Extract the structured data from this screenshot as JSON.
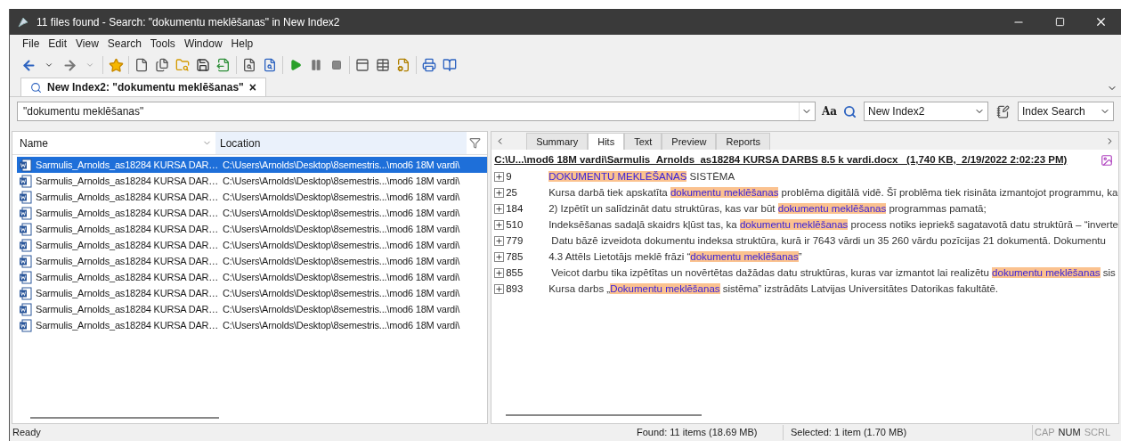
{
  "window": {
    "title": "11 files found - Search: \"dokumentu meklēšanas\" in New Index2"
  },
  "menu": [
    "File",
    "Edit",
    "View",
    "Search",
    "Tools",
    "Window",
    "Help"
  ],
  "doc_tab": {
    "label": "New Index2: \"dokumentu meklēšanas\"",
    "close": "×"
  },
  "search": {
    "value": "\"dokumentu meklēšanas\"",
    "case_button": "Aa",
    "index": "New Index2",
    "mode": "Index Search"
  },
  "results": {
    "columns": [
      "Name",
      "Location"
    ],
    "rows": [
      {
        "name": "Sarmulis_Arnolds_as18284 KURSA DAR…",
        "location": "C:\\Users\\Arnolds\\Desktop\\8semestris...\\mod6 18M vardi\\",
        "selected": true
      },
      {
        "name": "Sarmulis_Arnolds_as18284 KURSA DAR…",
        "location": "C:\\Users\\Arnolds\\Desktop\\8semestris...\\mod6 18M vardi\\",
        "selected": false
      },
      {
        "name": "Sarmulis_Arnolds_as18284 KURSA DAR…",
        "location": "C:\\Users\\Arnolds\\Desktop\\8semestris...\\mod6 18M vardi\\",
        "selected": false
      },
      {
        "name": "Sarmulis_Arnolds_as18284 KURSA DAR…",
        "location": "C:\\Users\\Arnolds\\Desktop\\8semestris...\\mod6 18M vardi\\",
        "selected": false
      },
      {
        "name": "Sarmulis_Arnolds_as18284 KURSA DAR…",
        "location": "C:\\Users\\Arnolds\\Desktop\\8semestris...\\mod6 18M vardi\\",
        "selected": false
      },
      {
        "name": "Sarmulis_Arnolds_as18284 KURSA DAR…",
        "location": "C:\\Users\\Arnolds\\Desktop\\8semestris...\\mod6 18M vardi\\",
        "selected": false
      },
      {
        "name": "Sarmulis_Arnolds_as18284 KURSA DAR…",
        "location": "C:\\Users\\Arnolds\\Desktop\\8semestris...\\mod6 18M vardi\\",
        "selected": false
      },
      {
        "name": "Sarmulis_Arnolds_as18284 KURSA DAR…",
        "location": "C:\\Users\\Arnolds\\Desktop\\8semestris...\\mod6 18M vardi\\",
        "selected": false
      },
      {
        "name": "Sarmulis_Arnolds_as18284 KURSA DAR…",
        "location": "C:\\Users\\Arnolds\\Desktop\\8semestris...\\mod6 18M vardi\\",
        "selected": false
      },
      {
        "name": "Sarmulis_Arnolds_as18284 KURSA DAR…",
        "location": "C:\\Users\\Arnolds\\Desktop\\8semestris...\\mod6 18M vardi\\",
        "selected": false
      },
      {
        "name": "Sarmulis_Arnolds_as18284 KURSA DAR…",
        "location": "C:\\Users\\Arnolds\\Desktop\\8semestris...\\mod6 18M vardi\\",
        "selected": false
      }
    ]
  },
  "viewer": {
    "tabs": [
      {
        "label": "Summary",
        "selected": false
      },
      {
        "label": "Hits",
        "selected": true
      },
      {
        "label": "Text",
        "selected": false
      },
      {
        "label": "Preview",
        "selected": false
      },
      {
        "label": "Reports",
        "selected": false
      }
    ],
    "file_header": "C:\\U...\\mod6 18M vardi\\Sarmulis_Arnolds_as18284 KURSA DARBS 8.5 k vardi.docx   (1,740 KB,  2/19/2022 2:02:23 PM)",
    "hits": [
      {
        "line": "9",
        "segments": [
          {
            "text": "DOKUMENTU MEKLĒŠANAS",
            "hit": true
          },
          {
            "text": " SISTĒMA",
            "hit": false
          }
        ]
      },
      {
        "line": "25",
        "segments": [
          {
            "text": "Kursa darbā tiek apskatīta ",
            "hit": false
          },
          {
            "text": "dokumentu meklēšanas",
            "hit": true
          },
          {
            "text": " problēma digitālā vidē. Šī problēma tiek risināta izmantojot programmu, ka",
            "hit": false
          }
        ]
      },
      {
        "line": "184",
        "segments": [
          {
            "text": "2) Izpētīt un salīdzināt datu struktūras, kas var būt ",
            "hit": false
          },
          {
            "text": "dokumentu meklēšanas",
            "hit": true
          },
          {
            "text": " programmas pamatā;",
            "hit": false
          }
        ]
      },
      {
        "line": "510",
        "segments": [
          {
            "text": "Indeksēšanas sadaļā skaidrs kļūst tas, ka ",
            "hit": false
          },
          {
            "text": "dokumentu meklēšanas",
            "hit": true
          },
          {
            "text": " process notiks iepriekš sagatavotā datu struktūrā – “inverte",
            "hit": false
          }
        ]
      },
      {
        "line": "779",
        "segments": [
          {
            "text": " Datu bāzē izveidota dokumentu indeksa struktūra, kurā ir 7643 vārdi un 35 260 vārdu pozīcijas 21 dokumentā. Dokumentu",
            "hit": false
          }
        ]
      },
      {
        "line": "785",
        "segments": [
          {
            "text": "4.3 Attēls Lietotājs meklē frāzi “",
            "hit": false
          },
          {
            "text": "dokumentu meklēšanas",
            "hit": true
          },
          {
            "text": "”",
            "hit": false
          }
        ]
      },
      {
        "line": "855",
        "segments": [
          {
            "text": " Veicot darbu tika izpētītas un novērtētas dažādas datu struktūras, kuras var izmantot lai realizētu ",
            "hit": false
          },
          {
            "text": "dokumentu meklēšanas",
            "hit": true
          },
          {
            "text": " sis",
            "hit": false
          }
        ]
      },
      {
        "line": "893",
        "segments": [
          {
            "text": "Kursa darbs „",
            "hit": false
          },
          {
            "text": "Dokumentu meklēšanas",
            "hit": true
          },
          {
            "text": " sistēma” izstrādāts Latvijas Universitātes Datorikas fakultātē.",
            "hit": false
          }
        ]
      }
    ]
  },
  "status_bar": {
    "message": "Ready",
    "found": "Found: 11 items (18.69 MB)",
    "selected": "Selected: 1 item (1.70 MB)",
    "indicators": [
      {
        "label": "CAP",
        "on": false
      },
      {
        "label": "NUM",
        "on": true
      },
      {
        "label": "SCRL",
        "on": false
      }
    ]
  }
}
